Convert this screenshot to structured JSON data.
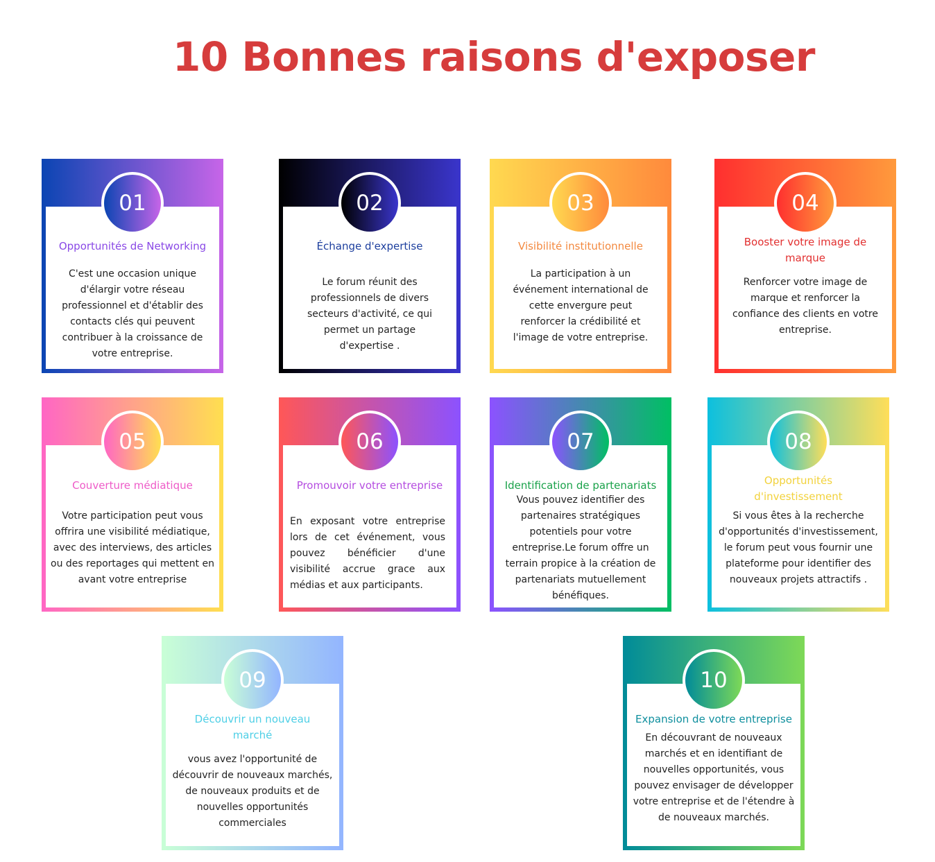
{
  "title": "10 Bonnes raisons d'exposer",
  "cards": [
    {
      "number": "01",
      "heading": "Opportunités de Networking",
      "heading_color": "#8a49e6",
      "gradient": [
        "#0b45b3",
        "#c765e8"
      ],
      "body": "C'est une occasion unique d'élargir votre réseau professionnel et d'établir des contacts clés qui peuvent contribuer à la croissance de votre entreprise."
    },
    {
      "number": "02",
      "heading": "Échange d'expertise",
      "heading_color": "#1d3f9e",
      "gradient": [
        "#000000",
        "#3a35cc"
      ],
      "body": "Le forum réunit des professionnels de divers secteurs d'activité, ce qui permet un partage d'expertise ."
    },
    {
      "number": "03",
      "heading": "Visibilité institutionnelle",
      "heading_color": "#f3893f",
      "gradient": [
        "#ffd950",
        "#ff8a3c"
      ],
      "body": "La participation à un événement international de cette envergure peut renforcer la crédibilité et l'image de votre entreprise."
    },
    {
      "number": "04",
      "heading": "Booster votre image de marque",
      "heading_color": "#e23030",
      "gradient": [
        "#ff2f2f",
        "#ff9a3c"
      ],
      "body": "Renforcer votre image de marque et renforcer la confiance des clients en votre entreprise."
    },
    {
      "number": "05",
      "heading": "Couverture médiatique",
      "heading_color": "#ee5bc8",
      "gradient": [
        "#ff66c4",
        "#ffdf50"
      ],
      "body": "Votre participation peut vous offrira une visibilité médiatique, avec des interviews, des articles ou des reportages qui mettent en avant votre entreprise"
    },
    {
      "number": "06",
      "heading": "Promouvoir votre entreprise",
      "heading_color": "#b54de0",
      "gradient": [
        "#ff5757",
        "#8c52ff"
      ],
      "body": "En exposant votre entreprise lors de cet événement, vous pouvez bénéficier d'une visibilité accrue grace aux médias et aux participants."
    },
    {
      "number": "07",
      "heading": "Identification de partenariats",
      "heading_color": "#1aa24a",
      "gradient": [
        "#8c52ff",
        "#00bf63"
      ],
      "body": "Vous pouvez identifier des partenaires stratégiques potentiels pour votre entreprise.Le forum offre un terrain propice à la création de partenariats mutuellement bénéfiques."
    },
    {
      "number": "08",
      "heading": "Opportunités d'investissement",
      "heading_color": "#f2d23c",
      "gradient": [
        "#0cc0df",
        "#ffde59"
      ],
      "body": "Si vous êtes à la recherche d'opportunités d'investissement, le forum peut vous fournir une plateforme pour identifier des nouveaux projets attractifs ."
    },
    {
      "number": "09",
      "heading": "Découvrir un nouveau marché",
      "heading_color": "#4ecfe6",
      "gradient": [
        "#c9ffd6",
        "#93b5ff"
      ],
      "body": "vous avez l'opportunité de découvrir de nouveaux marchés, de nouveaux produits et de nouvelles opportunités commerciales"
    },
    {
      "number": "10",
      "heading": "Expansion de votre entreprise",
      "heading_color": "#0f8f9e",
      "gradient": [
        "#008b99",
        "#7ed957"
      ],
      "body": "En découvrant de nouveaux marchés et en identifiant de nouvelles opportunités, vous pouvez envisager de développer votre entreprise et de l'étendre à de nouveaux marchés."
    }
  ]
}
